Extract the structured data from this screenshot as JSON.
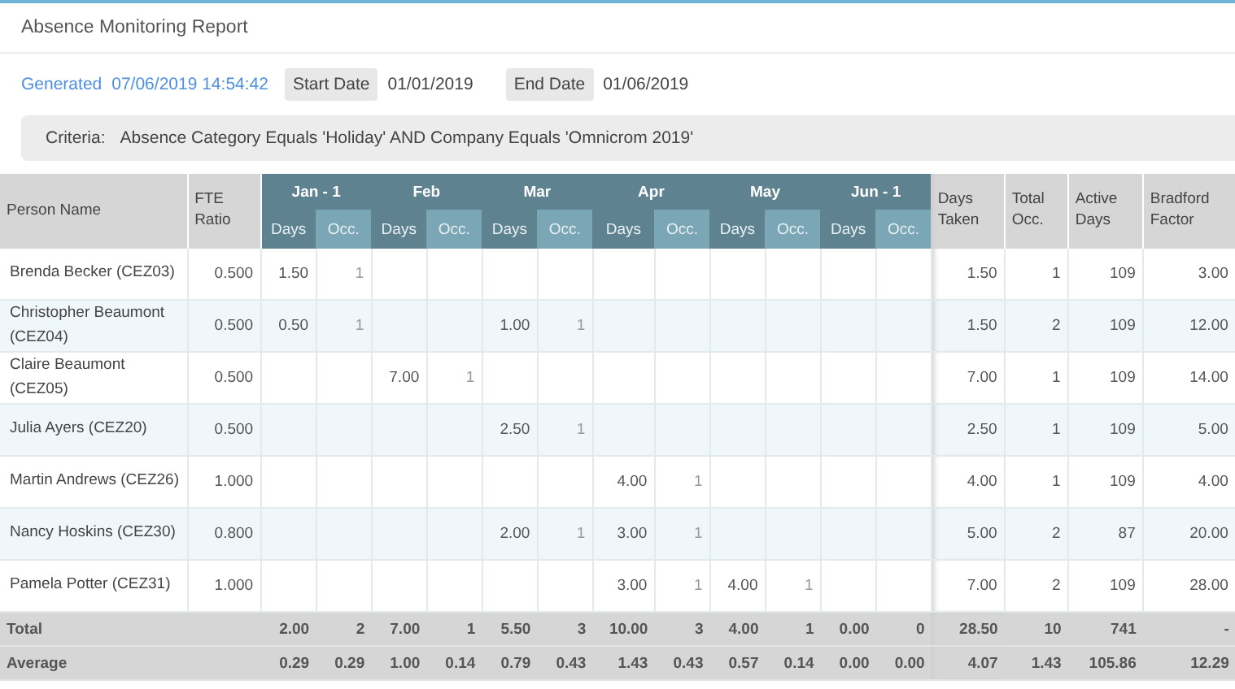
{
  "title": "Absence Monitoring Report",
  "generated": {
    "label": "Generated",
    "value": "07/06/2019 14:54:42"
  },
  "start_date": {
    "label": "Start Date",
    "value": "01/01/2019"
  },
  "end_date": {
    "label": "End Date",
    "value": "01/06/2019"
  },
  "criteria": {
    "label": "Criteria:",
    "value": "Absence Category Equals 'Holiday' AND Company Equals 'Omnicrom 2019'"
  },
  "table": {
    "columns": {
      "person": "Person Name",
      "fte": "FTE Ratio",
      "months": [
        {
          "label": "Jan - 1",
          "days": "Days",
          "occ": "Occ."
        },
        {
          "label": "Feb",
          "days": "Days",
          "occ": "Occ."
        },
        {
          "label": "Mar",
          "days": "Days",
          "occ": "Occ."
        },
        {
          "label": "Apr",
          "days": "Days",
          "occ": "Occ."
        },
        {
          "label": "May",
          "days": "Days",
          "occ": "Occ."
        },
        {
          "label": "Jun - 1",
          "days": "Days",
          "occ": "Occ."
        }
      ],
      "summary": [
        "Days Taken",
        "Total Occ.",
        "Active Days",
        "Bradford Factor"
      ]
    },
    "rows": [
      {
        "name": "Brenda Becker (CEZ03)",
        "fte": "0.500",
        "months": {
          "jan": {
            "days": "1.50",
            "occ": "1"
          }
        },
        "summary": [
          "1.50",
          "1",
          "109",
          "3.00"
        ]
      },
      {
        "name": "Christopher Beaumont (CEZ04)",
        "fte": "0.500",
        "months": {
          "jan": {
            "days": "0.50",
            "occ": "1"
          },
          "mar": {
            "days": "1.00",
            "occ": "1"
          }
        },
        "summary": [
          "1.50",
          "2",
          "109",
          "12.00"
        ]
      },
      {
        "name": "Claire Beaumont (CEZ05)",
        "fte": "0.500",
        "months": {
          "feb": {
            "days": "7.00",
            "occ": "1"
          }
        },
        "summary": [
          "7.00",
          "1",
          "109",
          "14.00"
        ]
      },
      {
        "name": "Julia Ayers (CEZ20)",
        "fte": "0.500",
        "months": {
          "mar": {
            "days": "2.50",
            "occ": "1"
          }
        },
        "summary": [
          "2.50",
          "1",
          "109",
          "5.00"
        ]
      },
      {
        "name": "Martin Andrews (CEZ26)",
        "fte": "1.000",
        "months": {
          "apr": {
            "days": "4.00",
            "occ": "1"
          }
        },
        "summary": [
          "4.00",
          "1",
          "109",
          "4.00"
        ]
      },
      {
        "name": "Nancy Hoskins (CEZ30)",
        "fte": "0.800",
        "months": {
          "mar": {
            "days": "2.00",
            "occ": "1"
          },
          "apr": {
            "days": "3.00",
            "occ": "1"
          }
        },
        "summary": [
          "5.00",
          "2",
          "87",
          "20.00"
        ]
      },
      {
        "name": "Pamela Potter (CEZ31)",
        "fte": "1.000",
        "months": {
          "apr": {
            "days": "3.00",
            "occ": "1"
          },
          "may": {
            "days": "4.00",
            "occ": "1"
          }
        },
        "summary": [
          "7.00",
          "2",
          "109",
          "28.00"
        ]
      }
    ],
    "footer": [
      {
        "label": "Total",
        "values": [
          "2.00",
          "2",
          "7.00",
          "1",
          "5.50",
          "3",
          "10.00",
          "3",
          "4.00",
          "1",
          "0.00",
          "0",
          "28.50",
          "10",
          "741",
          "-"
        ]
      },
      {
        "label": "Average",
        "values": [
          "0.29",
          "0.29",
          "1.00",
          "0.14",
          "0.79",
          "0.43",
          "1.43",
          "0.43",
          "0.57",
          "0.14",
          "0.00",
          "0.00",
          "4.07",
          "1.43",
          "105.86",
          "12.29"
        ]
      }
    ]
  }
}
